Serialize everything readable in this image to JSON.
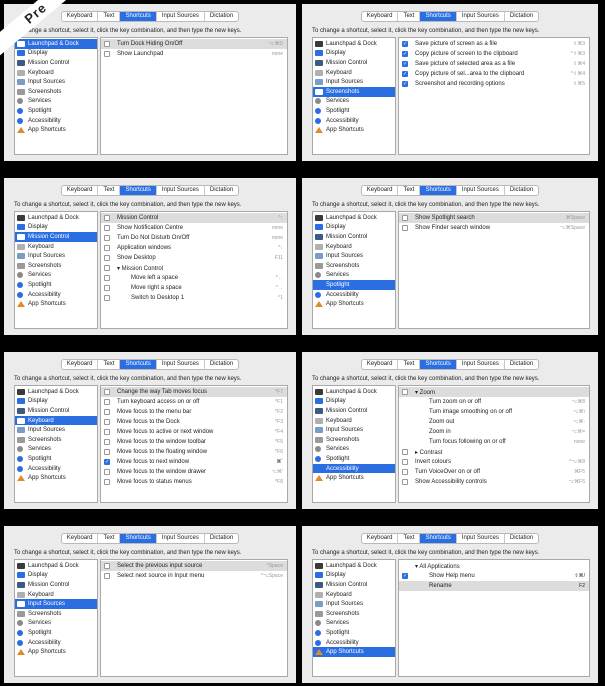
{
  "corner_ribbon": "Pre",
  "tab_labels": [
    "Keyboard",
    "Text",
    "Shortcuts",
    "Input Sources",
    "Dictation"
  ],
  "instruction": "To change a shortcut, select it, click the key combination, and then type the new keys.",
  "categories": [
    "Launchpad & Dock",
    "Display",
    "Mission Control",
    "Keyboard",
    "Input Sources",
    "Screenshots",
    "Services",
    "Spotlight",
    "Accessibility",
    "App Shortcuts"
  ],
  "category_icons": [
    "launchpad-icon",
    "display-icon",
    "mission-control-icon",
    "keyboard-icon",
    "input-sources-icon",
    "screenshots-icon",
    "services-icon",
    "spotlight-icon",
    "accessibility-icon",
    "app-shortcuts-icon"
  ],
  "colors": {
    "accent": "#2a6ee2",
    "panel": "#ebebeb",
    "highlight": "#dcdcdc"
  },
  "panels": [
    {
      "selected": 0,
      "rows": [
        {
          "cb": false,
          "label": "Turn Dock Hiding On/Off",
          "key": "⌥⌘D",
          "hl": true
        },
        {
          "cb": false,
          "label": "Show Launchpad",
          "key": "none"
        }
      ]
    },
    {
      "selected": 5,
      "rows": [
        {
          "cb": true,
          "label": "Save picture of screen as a file",
          "key": "⇧⌘3"
        },
        {
          "cb": true,
          "label": "Copy picture of screen to the clipboard",
          "key": "^⇧⌘3"
        },
        {
          "cb": true,
          "label": "Save picture of selected area as a file",
          "key": "⇧⌘4"
        },
        {
          "cb": true,
          "label": "Copy picture of sel...area to the clipboard",
          "key": "^⇧⌘4"
        },
        {
          "cb": true,
          "label": "Screenshot and recording options",
          "key": "⇧⌘5"
        }
      ]
    },
    {
      "selected": 2,
      "rows": [
        {
          "cb": false,
          "label": "Mission Control",
          "key": "^↑",
          "hl": true
        },
        {
          "cb": false,
          "label": "Show Notification Centre",
          "key": "none"
        },
        {
          "cb": false,
          "label": "Turn Do Not Disturb On/Off",
          "key": "none"
        },
        {
          "cb": false,
          "label": "Application windows",
          "key": "^↓"
        },
        {
          "cb": false,
          "label": "Show Desktop",
          "key": "F11"
        },
        {
          "cb": false,
          "label": "▾ Mission Control",
          "key": ""
        },
        {
          "cb": false,
          "label": "Move left a space",
          "key": "^←",
          "indent": true
        },
        {
          "cb": false,
          "label": "Move right a space",
          "key": "^→",
          "indent": true
        },
        {
          "cb": false,
          "label": "Switch to Desktop 1",
          "key": "^1",
          "indent": true
        }
      ]
    },
    {
      "selected": 7,
      "rows": [
        {
          "cb": false,
          "label": "Show Spotlight search",
          "key": "⌘Space",
          "hl": true
        },
        {
          "cb": false,
          "label": "Show Finder search window",
          "key": "⌥⌘Space"
        }
      ]
    },
    {
      "selected": 3,
      "rows": [
        {
          "cb": false,
          "label": "Change the way Tab moves focus",
          "key": "^F7",
          "hl": true
        },
        {
          "cb": false,
          "label": "Turn keyboard access on or off",
          "key": "^F1"
        },
        {
          "cb": false,
          "label": "Move focus to the menu bar",
          "key": "^F2"
        },
        {
          "cb": false,
          "label": "Move focus to the Dock",
          "key": "^F3"
        },
        {
          "cb": false,
          "label": "Move focus to active or next window",
          "key": "^F4"
        },
        {
          "cb": false,
          "label": "Move focus to the window toolbar",
          "key": "^F5"
        },
        {
          "cb": false,
          "label": "Move focus to the floating window",
          "key": "^F6"
        },
        {
          "cb": true,
          "label": "Move focus to next window",
          "key": "⌘`",
          "dark": true
        },
        {
          "cb": false,
          "label": "Move focus to the window drawer",
          "key": "⌥⌘'"
        },
        {
          "cb": false,
          "label": "Move focus to status menus",
          "key": "^F8"
        }
      ]
    },
    {
      "selected": 8,
      "rows": [
        {
          "cb": false,
          "label": "▾ Zoom",
          "key": "",
          "hl": true
        },
        {
          "cb": false,
          "nocb": true,
          "label": "Turn zoom on or off",
          "key": "⌥⌘8",
          "indent": true
        },
        {
          "cb": false,
          "nocb": true,
          "label": "Turn image smoothing on or off",
          "key": "⌥⌘\\",
          "indent": true
        },
        {
          "cb": false,
          "nocb": true,
          "label": "Zoom out",
          "key": "⌥⌘-",
          "indent": true
        },
        {
          "cb": false,
          "nocb": true,
          "label": "Zoom in",
          "key": "⌥⌘=",
          "indent": true
        },
        {
          "cb": false,
          "nocb": true,
          "label": "Turn focus following on or off",
          "key": "none",
          "indent": true
        },
        {
          "cb": false,
          "label": "▸ Contrast",
          "key": ""
        },
        {
          "cb": false,
          "label": "Invert colours",
          "key": "^⌥⌘8"
        },
        {
          "cb": false,
          "label": "Turn VoiceOver on or off",
          "key": "⌘F5"
        },
        {
          "cb": false,
          "label": "Show Accessibility controls",
          "key": "⌥⌘F5"
        }
      ]
    },
    {
      "selected": 4,
      "rows": [
        {
          "cb": false,
          "label": "Select the previous input source",
          "key": "^Space",
          "hl": true
        },
        {
          "cb": false,
          "label": "Select next source in Input menu",
          "key": "^⌥Space"
        }
      ]
    },
    {
      "selected": 9,
      "rows": [
        {
          "cb": false,
          "nocb": true,
          "label": "▾ All Applications",
          "key": ""
        },
        {
          "cb": true,
          "label": "Show Help menu",
          "key": "⇧⌘/",
          "indent": true,
          "dark": true
        },
        {
          "cb": false,
          "nocb": true,
          "label": "Rename",
          "key": "F2",
          "indent": true,
          "hl": true,
          "dark": true
        }
      ]
    }
  ]
}
